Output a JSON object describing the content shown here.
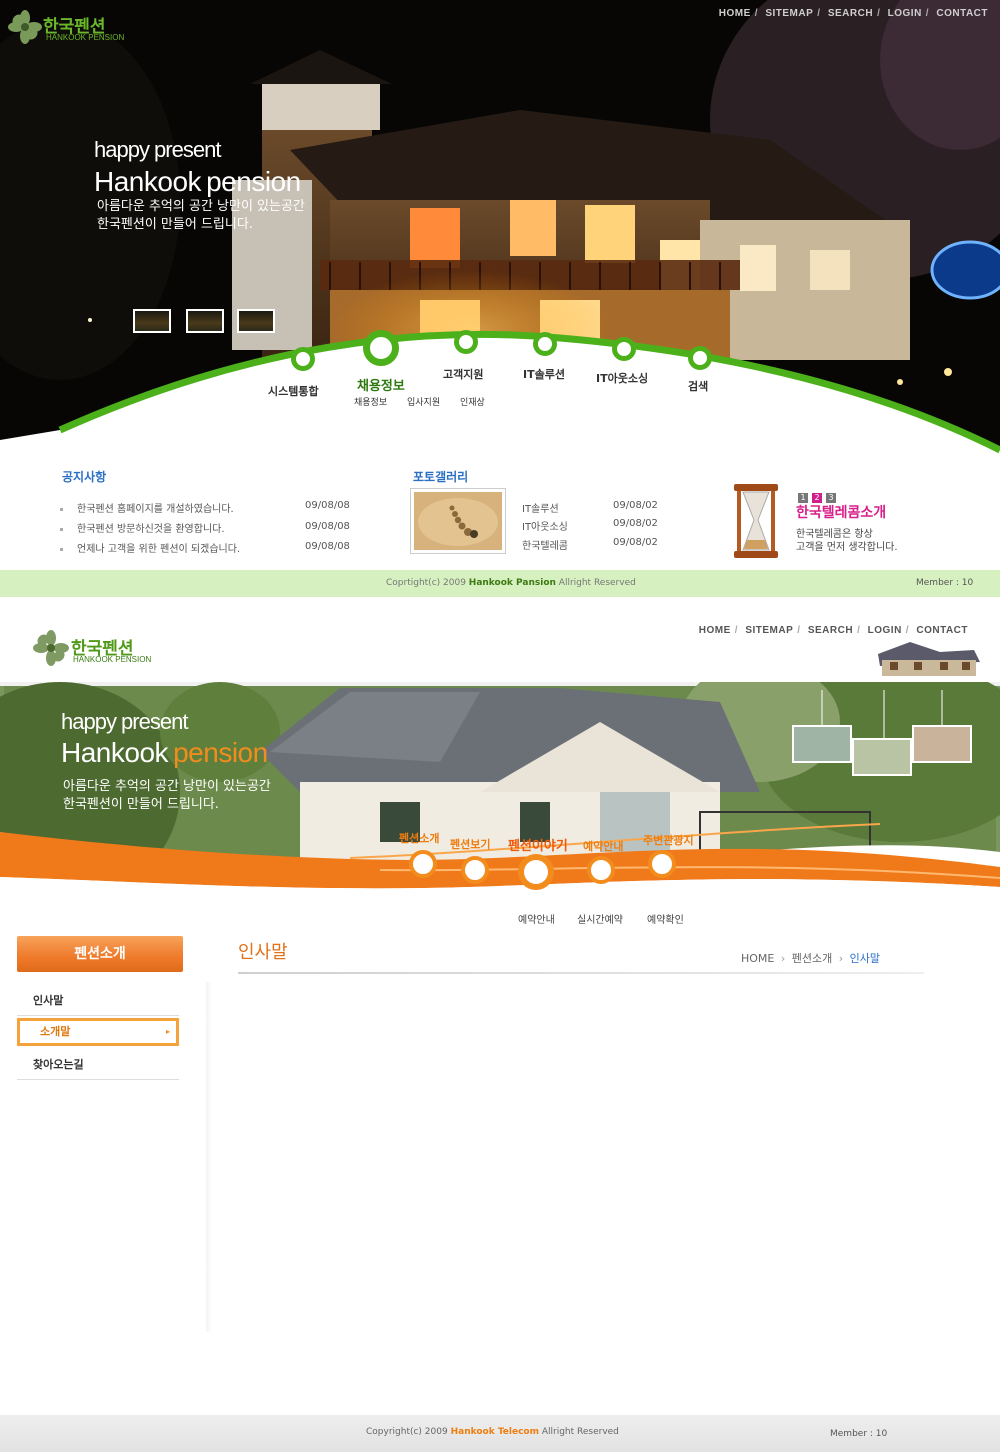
{
  "top_design": {
    "logo": {
      "title": "한국펜션",
      "subtitle": "HANKOOK PENSION"
    },
    "top_nav": [
      "HOME",
      "SITEMAP",
      "SEARCH",
      "LOGIN",
      "CONTACT"
    ],
    "hero": {
      "tagline": "happy present",
      "title_part1": "Hankook",
      "title_part2": "pension",
      "line1": "아름다운 추억의 공간  낭만이 있는공간",
      "line2": "한국펜션이 만들어 드립니다."
    },
    "menu": [
      {
        "label": "시스템통합"
      },
      {
        "label": "채용정보",
        "active": true,
        "subs": [
          "채용정보",
          "입사지원",
          "인재상"
        ]
      },
      {
        "label": "고객지원"
      },
      {
        "label": "IT솔루션"
      },
      {
        "label": "IT아웃소싱"
      },
      {
        "label": "검색"
      }
    ],
    "notice": {
      "title": "공지사항",
      "items": [
        {
          "text": "한국펜션 홈페이지를 개설하였습니다.",
          "date": "09/08/08"
        },
        {
          "text": "한국펜션 방문하신것을 환영합니다.",
          "date": "09/08/08"
        },
        {
          "text": "언제나 고객을 위한 펜션이 되겠습니다.",
          "date": "09/08/08"
        }
      ]
    },
    "gallery": {
      "title": "포토갤러리",
      "items": [
        {
          "text": "IT솔루션",
          "date": "09/08/02"
        },
        {
          "text": "IT아웃소싱",
          "date": "09/08/02"
        },
        {
          "text": "한국텔레콤",
          "date": "09/08/02"
        }
      ]
    },
    "promo": {
      "pages": [
        "1",
        "2",
        "3"
      ],
      "active_page": "2",
      "title": "한국텔레콤소개",
      "line1": "한국텔레콤은 항상",
      "line2": "고객을 먼저 생각합니다."
    },
    "footer": {
      "copy_prefix": "Coprtight(c) 2009",
      "copy_brand": "Hankook Pansion",
      "copy_suffix": "Allright Reserved",
      "member": "Member : 10"
    },
    "colors": {
      "accent": "#4cb01a",
      "footer_bg": "#d6f0c0"
    }
  },
  "bottom_design": {
    "logo": {
      "title": "한국펜션",
      "subtitle": "HANKOOK PENSION"
    },
    "top_nav": [
      "HOME",
      "SITEMAP",
      "SEARCH",
      "LOGIN",
      "CONTACT"
    ],
    "hero": {
      "tagline": "happy present",
      "title_part1": "Hankook",
      "title_part2": "pension",
      "line1": "아름다운 추억의 공간  낭만이 있는공간",
      "line2": "한국펜션이 만들어 드립니다."
    },
    "menu": [
      {
        "label": "펜션소개"
      },
      {
        "label": "펜션보기"
      },
      {
        "label": "펜션이야기",
        "active": true
      },
      {
        "label": "예약안내"
      },
      {
        "label": "주변관광지"
      }
    ],
    "submenu": [
      "예약안내",
      "실시간예약",
      "예약확인"
    ],
    "sidebar": {
      "title": "펜션소개",
      "items": [
        {
          "label": "인사말"
        },
        {
          "label": "소개말",
          "active": true
        },
        {
          "label": "찾아오는길"
        }
      ]
    },
    "content": {
      "title": "인사말",
      "breadcrumb": [
        "HOME",
        "펜션소개",
        "인사말"
      ]
    },
    "footer": {
      "copy_prefix": "Copyright(c) 2009",
      "copy_brand": "Hankook Telecom",
      "copy_suffix": "Allright Reserved",
      "member": "Member : 10"
    },
    "colors": {
      "accent": "#f28c1c",
      "sidebar_button": "#ee7a2a"
    }
  }
}
